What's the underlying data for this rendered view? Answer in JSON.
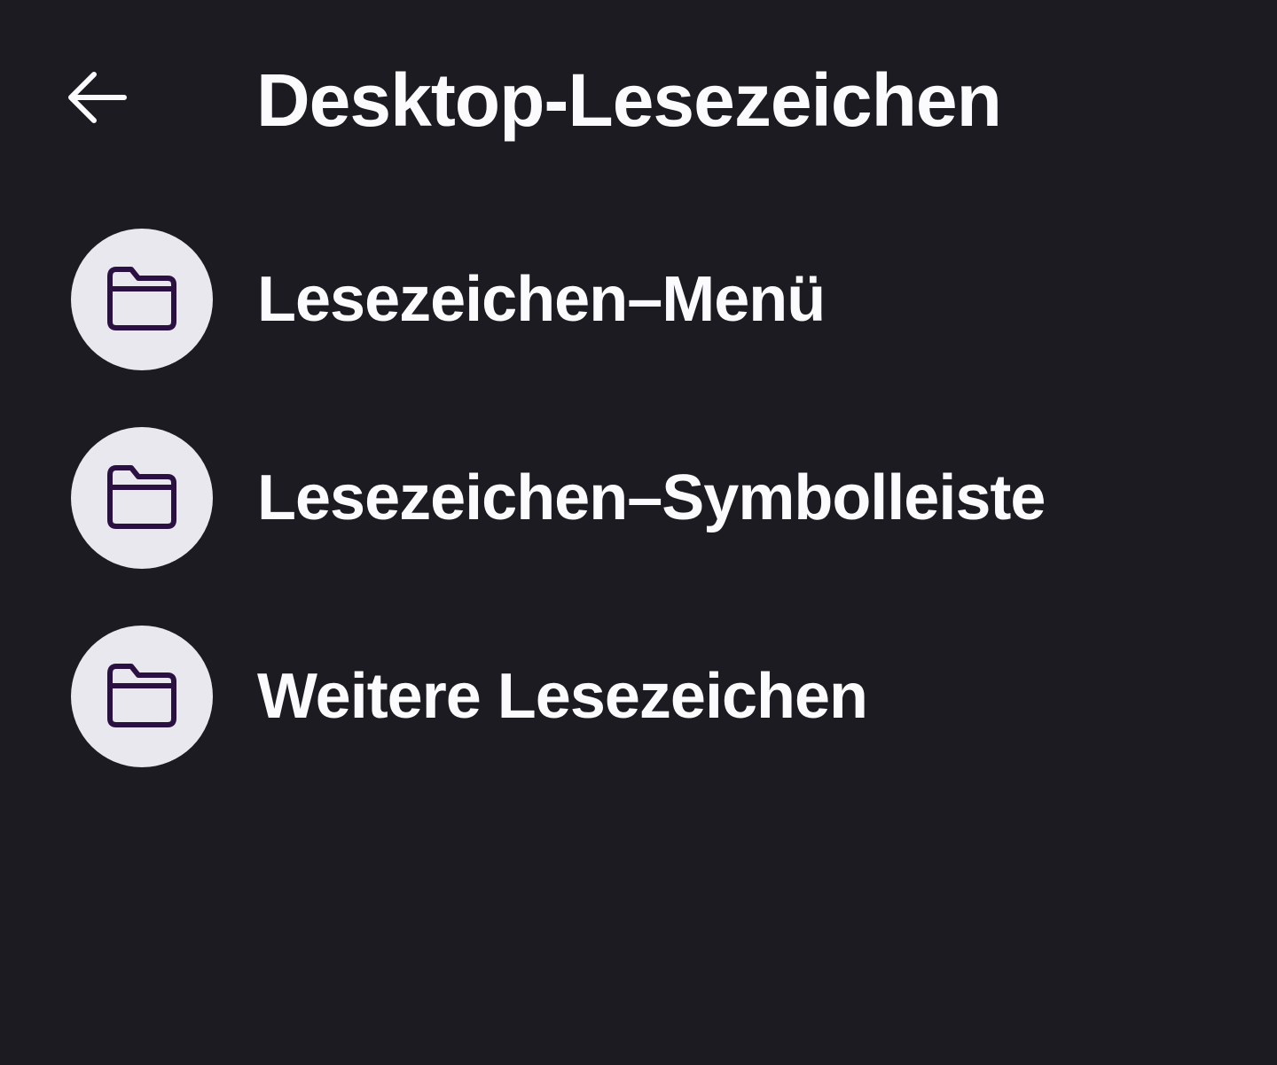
{
  "header": {
    "title": "Desktop-Lesezeichen",
    "back_icon": "arrow-left-icon"
  },
  "folders": [
    {
      "label": "Lesezeichen–Menü",
      "icon": "folder-icon"
    },
    {
      "label": "Lesezeichen–Symbolleiste",
      "icon": "folder-icon"
    },
    {
      "label": "Weitere Lesezeichen",
      "icon": "folder-icon"
    }
  ],
  "colors": {
    "background": "#1c1b22",
    "text": "#fbfbfe",
    "avatar_bg": "#e9e8ee",
    "folder_stroke": "#2b1141"
  }
}
